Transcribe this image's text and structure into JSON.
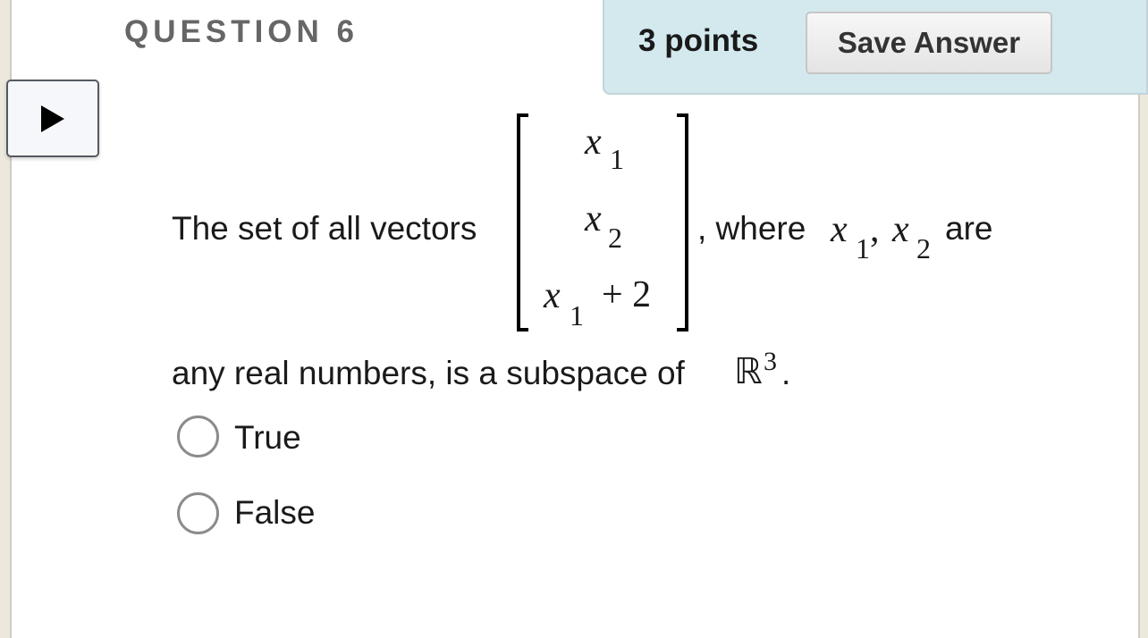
{
  "question": {
    "title": "QUESTION 6",
    "points": "3 points",
    "save_label": "Save Answer",
    "prompt": {
      "before_matrix": "The set of all vectors",
      "after_matrix": ", where",
      "are": "are",
      "line2": "any real numbers, is a subspace of",
      "period": "."
    },
    "matrix": {
      "row1": {
        "var": "x",
        "sub": "1"
      },
      "row2": {
        "var": "x",
        "sub": "2"
      },
      "row3": {
        "var": "x",
        "sub": "1",
        "rest": "+ 2"
      }
    },
    "vars": {
      "v1": "x",
      "s1": "1",
      "comma": ",",
      "v2": "x",
      "s2": "2"
    },
    "space": {
      "symbol": "ℝ",
      "exp": "3"
    },
    "options": [
      {
        "label": "True",
        "selected": false
      },
      {
        "label": "False",
        "selected": false
      }
    ]
  },
  "colors": {
    "header_bg": "#d3e9ee",
    "title": "#666666"
  },
  "icons": {
    "play": "play-icon"
  }
}
